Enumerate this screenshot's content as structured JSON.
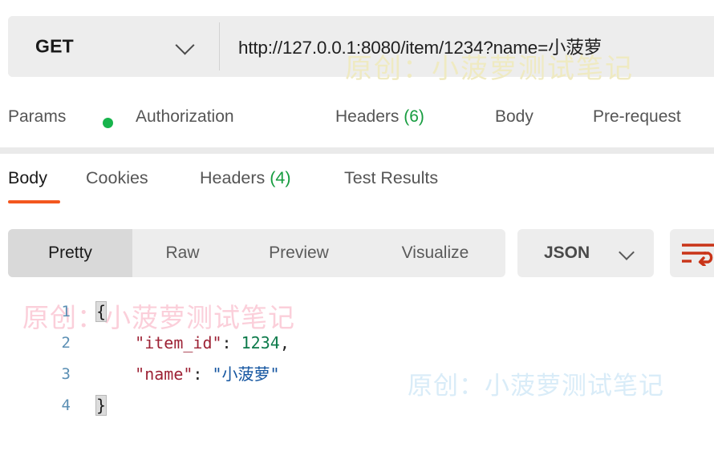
{
  "request_bar": {
    "method": "GET",
    "method_chevron_icon": "chevron-down-icon",
    "url": "http://127.0.0.1:8080/item/1234?name=小菠萝"
  },
  "watermarks": {
    "url_bar": "原创：小菠萝测试笔记",
    "json_left": "原创：小菠萝测试笔记",
    "json_right": "原创：小菠萝测试笔记",
    "color_url_bar": "#efeac2",
    "color_json_left": "#fbcfda",
    "color_json_right": "#d9ecf8"
  },
  "request_tabs": [
    {
      "label": "Params",
      "badge_dot": true,
      "active": false
    },
    {
      "label": "Authorization",
      "active": false
    },
    {
      "label": "Headers",
      "count": "(6)",
      "active": false
    },
    {
      "label": "Body",
      "active": false
    },
    {
      "label": "Pre-request",
      "active": false
    }
  ],
  "response_tabs": [
    {
      "label": "Body",
      "active": true
    },
    {
      "label": "Cookies",
      "active": false
    },
    {
      "label": "Headers",
      "count": "(4)",
      "active": false
    },
    {
      "label": "Test Results",
      "active": false
    }
  ],
  "view_toolbar": {
    "segments": [
      {
        "label": "Pretty",
        "active": true
      },
      {
        "label": "Raw",
        "active": false
      },
      {
        "label": "Preview",
        "active": false
      },
      {
        "label": "Visualize",
        "active": false
      }
    ],
    "format": "JSON",
    "format_chevron_icon": "chevron-down-icon",
    "wrap_icon": "word-wrap-icon",
    "wrap_icon_color": "#c93418"
  },
  "response_body": {
    "language": "json",
    "lines": [
      {
        "number": "1",
        "tokens": [
          {
            "text": "{",
            "type": "brace"
          }
        ]
      },
      {
        "number": "2",
        "tokens": [
          {
            "text": "    ",
            "type": "punct"
          },
          {
            "text": "\"item_id\"",
            "type": "key"
          },
          {
            "text": ": ",
            "type": "punct"
          },
          {
            "text": "1234",
            "type": "num"
          },
          {
            "text": ",",
            "type": "punct"
          }
        ]
      },
      {
        "number": "3",
        "tokens": [
          {
            "text": "    ",
            "type": "punct"
          },
          {
            "text": "\"name\"",
            "type": "key"
          },
          {
            "text": ": ",
            "type": "punct"
          },
          {
            "text": "\"小菠萝\"",
            "type": "str"
          }
        ]
      },
      {
        "number": "4",
        "tokens": [
          {
            "text": "}",
            "type": "brace"
          }
        ]
      }
    ],
    "raw_text": "{\n    \"item_id\": 1234,\n    \"name\": \"小菠萝\"\n}"
  },
  "colors": {
    "accent_orange": "#f3571f",
    "dot_green": "#17b44c",
    "count_green": "#169c3f",
    "control_bg": "#ededed",
    "control_active_bg": "#d9d9d9"
  }
}
